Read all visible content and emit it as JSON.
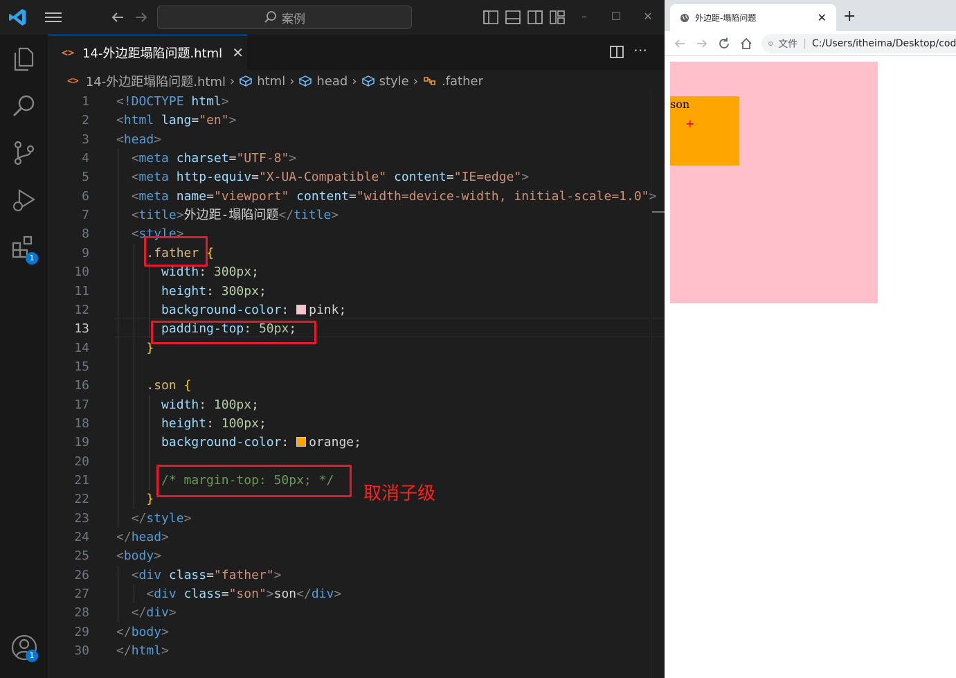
{
  "vscode": {
    "search_placeholder": "案例",
    "tab": {
      "filename": "14-外边距塌陷问题.html",
      "close": "✕"
    },
    "breadcrumb": {
      "file": "14-外边距塌陷问题.html",
      "items": [
        "html",
        "head",
        "style",
        ".father"
      ]
    },
    "badges": {
      "extensions": "1",
      "accounts": "1"
    },
    "active_line": 13,
    "annotation": "取消子级",
    "lines": [
      {
        "n": "1"
      },
      {
        "n": "2"
      },
      {
        "n": "3"
      },
      {
        "n": "4"
      },
      {
        "n": "5"
      },
      {
        "n": "6"
      },
      {
        "n": "7"
      },
      {
        "n": "8"
      },
      {
        "n": "9"
      },
      {
        "n": "10"
      },
      {
        "n": "11"
      },
      {
        "n": "12"
      },
      {
        "n": "13"
      },
      {
        "n": "14"
      },
      {
        "n": "15"
      },
      {
        "n": "16"
      },
      {
        "n": "17"
      },
      {
        "n": "18"
      },
      {
        "n": "19"
      },
      {
        "n": "20"
      },
      {
        "n": "21"
      },
      {
        "n": "22"
      },
      {
        "n": "23"
      },
      {
        "n": "24"
      },
      {
        "n": "25"
      },
      {
        "n": "26"
      },
      {
        "n": "27"
      },
      {
        "n": "28"
      },
      {
        "n": "29"
      },
      {
        "n": "30"
      }
    ],
    "code": {
      "l1": {
        "doctype": "!DOCTYPE",
        "html": "html"
      },
      "l2": {
        "tag": "html",
        "attr": "lang",
        "val": "\"en\""
      },
      "l3": {
        "tag": "head"
      },
      "l4": {
        "tag": "meta",
        "attr": "charset",
        "val": "\"UTF-8\""
      },
      "l5": {
        "tag": "meta",
        "attr1": "http-equiv",
        "val1": "\"X-UA-Compatible\"",
        "attr2": "content",
        "val2": "\"IE=edge\""
      },
      "l6": {
        "tag": "meta",
        "attr1": "name",
        "val1": "\"viewport\"",
        "attr2": "content",
        "val2": "\"width=device-width, initial-scale=1.0\""
      },
      "l7": {
        "tag": "title",
        "text": "外边距-塌陷问题"
      },
      "l8": {
        "tag": "style"
      },
      "l9": {
        "sel": ".father",
        "brace": "{"
      },
      "l10": {
        "prop": "width",
        "num": "300",
        "unit": "px"
      },
      "l11": {
        "prop": "height",
        "num": "300",
        "unit": "px"
      },
      "l12": {
        "prop": "background-color",
        "val": "pink"
      },
      "l13": {
        "prop": "padding-top",
        "num": "50",
        "unit": "px"
      },
      "l14": {
        "brace": "}"
      },
      "l16": {
        "sel": ".son",
        "brace": "{"
      },
      "l17": {
        "prop": "width",
        "num": "100",
        "unit": "px"
      },
      "l18": {
        "prop": "height",
        "num": "100",
        "unit": "px"
      },
      "l19": {
        "prop": "background-color",
        "val": "orange"
      },
      "l21": {
        "comment": "/* margin-top: 50px; */"
      },
      "l22": {
        "brace": "}"
      },
      "l23": {
        "tag": "style"
      },
      "l24": {
        "tag": "head"
      },
      "l25": {
        "tag": "body"
      },
      "l26": {
        "tag": "div",
        "attr": "class",
        "val": "\"father\""
      },
      "l27": {
        "tag": "div",
        "attr": "class",
        "val": "\"son\"",
        "text": "son"
      },
      "l28": {
        "tag": "div"
      },
      "l29": {
        "tag": "body"
      },
      "l30": {
        "tag": "html"
      }
    }
  },
  "browser": {
    "tab_title": "外边距-塌陷问题",
    "file_label": "文件",
    "url": "C:/Users/itheima/Desktop/code",
    "page": {
      "son_text": "son",
      "father_color": "#ffc0cb",
      "son_color": "#ffa500"
    }
  }
}
